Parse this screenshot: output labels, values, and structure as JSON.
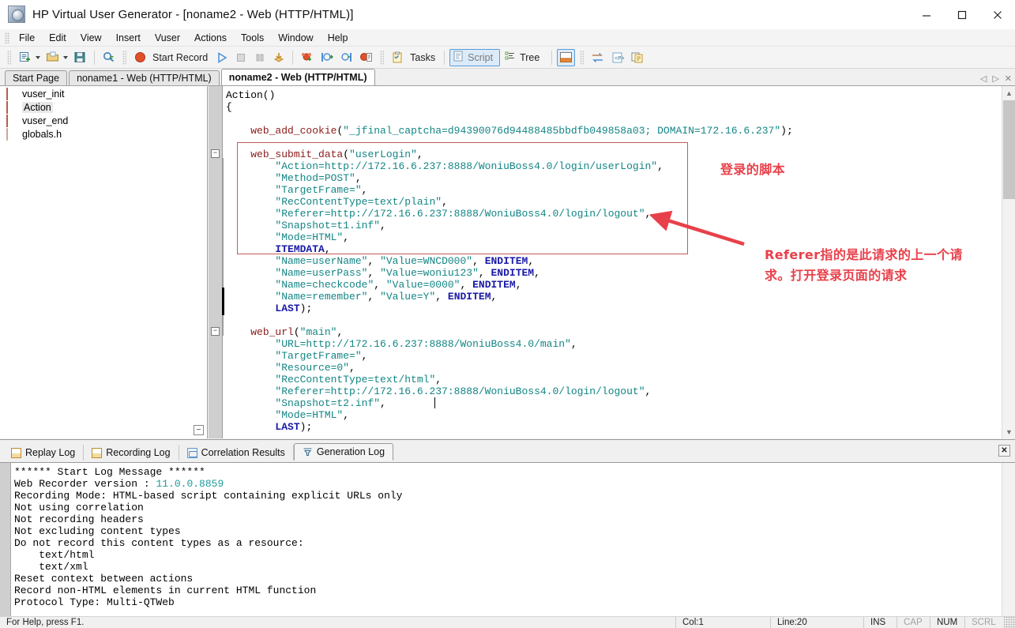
{
  "window": {
    "title": "HP Virtual User Generator - [noname2 - Web (HTTP/HTML)]",
    "app_icon": "vugen-app-icon",
    "minimize": "minimize-icon",
    "maximize": "maximize-icon",
    "close": "close-icon"
  },
  "menu": {
    "items": [
      {
        "label": "File"
      },
      {
        "label": "Edit"
      },
      {
        "label": "View"
      },
      {
        "label": "Insert"
      },
      {
        "label": "Vuser"
      },
      {
        "label": "Actions"
      },
      {
        "label": "Tools"
      },
      {
        "label": "Window"
      },
      {
        "label": "Help"
      }
    ]
  },
  "toolbar": {
    "new_script": "new-script-icon",
    "open": "open-folder-icon",
    "save": "save-disk-icon",
    "zoom": "find-icon",
    "record_dot": "record-dot-icon",
    "record_label": "Start Record",
    "run": "run-play-icon",
    "stop": "stop-icon",
    "pause": "pause-icon",
    "download": "download-icon",
    "runtime_settings": "runtime-settings-icon",
    "step_into": "step-into-icon",
    "step_out": "step-out-icon",
    "recording_options": "recording-options-icon",
    "tasks_label": "Tasks",
    "tasks_icon": "tasks-checklist-icon",
    "script_label": "Script",
    "script_icon": "script-view-icon",
    "tree_label": "Tree",
    "tree_icon": "tree-view-icon",
    "output_icon": "output-window-icon",
    "compare_icon": "compare-icon",
    "param_icon": "parameter-icon",
    "snapshot_icon": "snapshot-icon"
  },
  "document_tabs": {
    "items": [
      {
        "label": "Start Page",
        "active": false
      },
      {
        "label": "noname1 - Web (HTTP/HTML)",
        "active": false
      },
      {
        "label": "noname2 - Web (HTTP/HTML)",
        "active": true
      }
    ],
    "nav_prev": "nav-prev-icon",
    "nav_next": "nav-next-icon",
    "nav_close": "nav-close-icon"
  },
  "tree": {
    "items": [
      {
        "label": "vuser_init",
        "icon": "action-brick-icon",
        "selected": false
      },
      {
        "label": "Action",
        "icon": "action-brick-icon",
        "selected": true
      },
      {
        "label": "vuser_end",
        "icon": "action-brick-icon",
        "selected": false
      },
      {
        "label": "globals.h",
        "icon": "header-file-icon",
        "selected": false
      }
    ],
    "collapse_toggle": "collapse-minus-icon"
  },
  "code": {
    "lines": [
      [
        {
          "t": "Action()",
          "c": "plain"
        }
      ],
      [
        {
          "t": "{",
          "c": "plain"
        }
      ],
      [],
      [
        {
          "t": "    ",
          "c": "plain"
        },
        {
          "t": "web_add_cookie",
          "c": "fn"
        },
        {
          "t": "(",
          "c": "plain"
        },
        {
          "t": "\"_jfinal_captcha=d94390076d94488485bbdfb049858a03; DOMAIN=172.16.6.237\"",
          "c": "str"
        },
        {
          "t": ");",
          "c": "plain"
        }
      ],
      [],
      [
        {
          "t": "    ",
          "c": "plain"
        },
        {
          "t": "web_submit_data",
          "c": "fn"
        },
        {
          "t": "(",
          "c": "plain"
        },
        {
          "t": "\"userLogin\"",
          "c": "str"
        },
        {
          "t": ",",
          "c": "plain"
        }
      ],
      [
        {
          "t": "        ",
          "c": "plain"
        },
        {
          "t": "\"Action=http://172.16.6.237:8888/WoniuBoss4.0/login/userLogin\"",
          "c": "str"
        },
        {
          "t": ",",
          "c": "plain"
        }
      ],
      [
        {
          "t": "        ",
          "c": "plain"
        },
        {
          "t": "\"Method=POST\"",
          "c": "str"
        },
        {
          "t": ",",
          "c": "plain"
        }
      ],
      [
        {
          "t": "        ",
          "c": "plain"
        },
        {
          "t": "\"TargetFrame=\"",
          "c": "str"
        },
        {
          "t": ",",
          "c": "plain"
        }
      ],
      [
        {
          "t": "        ",
          "c": "plain"
        },
        {
          "t": "\"RecContentType=text/plain\"",
          "c": "str"
        },
        {
          "t": ",",
          "c": "plain"
        }
      ],
      [
        {
          "t": "        ",
          "c": "plain"
        },
        {
          "t": "\"Referer=http://172.16.6.237:8888/WoniuBoss4.0/login/logout\"",
          "c": "str"
        },
        {
          "t": ",",
          "c": "plain"
        }
      ],
      [
        {
          "t": "        ",
          "c": "plain"
        },
        {
          "t": "\"Snapshot=t1.inf\"",
          "c": "str"
        },
        {
          "t": ",",
          "c": "plain"
        }
      ],
      [
        {
          "t": "        ",
          "c": "plain"
        },
        {
          "t": "\"Mode=HTML\"",
          "c": "str"
        },
        {
          "t": ",",
          "c": "plain"
        }
      ],
      [
        {
          "t": "        ",
          "c": "plain"
        },
        {
          "t": "ITEMDATA",
          "c": "kw"
        },
        {
          "t": ",",
          "c": "plain"
        }
      ],
      [
        {
          "t": "        ",
          "c": "plain"
        },
        {
          "t": "\"Name=userName\"",
          "c": "str"
        },
        {
          "t": ", ",
          "c": "plain"
        },
        {
          "t": "\"Value=WNCD000\"",
          "c": "str"
        },
        {
          "t": ", ",
          "c": "plain"
        },
        {
          "t": "ENDITEM",
          "c": "kw"
        },
        {
          "t": ",",
          "c": "plain"
        }
      ],
      [
        {
          "t": "        ",
          "c": "plain"
        },
        {
          "t": "\"Name=userPass\"",
          "c": "str"
        },
        {
          "t": ", ",
          "c": "plain"
        },
        {
          "t": "\"Value=woniu123\"",
          "c": "str"
        },
        {
          "t": ", ",
          "c": "plain"
        },
        {
          "t": "ENDITEM",
          "c": "kw"
        },
        {
          "t": ",",
          "c": "plain"
        }
      ],
      [
        {
          "t": "        ",
          "c": "plain"
        },
        {
          "t": "\"Name=checkcode\"",
          "c": "str"
        },
        {
          "t": ", ",
          "c": "plain"
        },
        {
          "t": "\"Value=0000\"",
          "c": "str"
        },
        {
          "t": ", ",
          "c": "plain"
        },
        {
          "t": "ENDITEM",
          "c": "kw"
        },
        {
          "t": ",",
          "c": "plain"
        }
      ],
      [
        {
          "t": "        ",
          "c": "plain"
        },
        {
          "t": "\"Name=remember\"",
          "c": "str"
        },
        {
          "t": ", ",
          "c": "plain"
        },
        {
          "t": "\"Value=Y\"",
          "c": "str"
        },
        {
          "t": ", ",
          "c": "plain"
        },
        {
          "t": "ENDITEM",
          "c": "kw"
        },
        {
          "t": ",",
          "c": "plain"
        }
      ],
      [
        {
          "t": "        ",
          "c": "plain"
        },
        {
          "t": "LAST",
          "c": "kw"
        },
        {
          "t": ");",
          "c": "plain"
        }
      ],
      [],
      [
        {
          "t": "    ",
          "c": "plain"
        },
        {
          "t": "web_url",
          "c": "fn"
        },
        {
          "t": "(",
          "c": "plain"
        },
        {
          "t": "\"main\"",
          "c": "str"
        },
        {
          "t": ",",
          "c": "plain"
        }
      ],
      [
        {
          "t": "        ",
          "c": "plain"
        },
        {
          "t": "\"URL=http://172.16.6.237:8888/WoniuBoss4.0/main\"",
          "c": "str"
        },
        {
          "t": ",",
          "c": "plain"
        }
      ],
      [
        {
          "t": "        ",
          "c": "plain"
        },
        {
          "t": "\"TargetFrame=\"",
          "c": "str"
        },
        {
          "t": ",",
          "c": "plain"
        }
      ],
      [
        {
          "t": "        ",
          "c": "plain"
        },
        {
          "t": "\"Resource=0\"",
          "c": "str"
        },
        {
          "t": ",",
          "c": "plain"
        }
      ],
      [
        {
          "t": "        ",
          "c": "plain"
        },
        {
          "t": "\"RecContentType=text/html\"",
          "c": "str"
        },
        {
          "t": ",",
          "c": "plain"
        }
      ],
      [
        {
          "t": "        ",
          "c": "plain"
        },
        {
          "t": "\"Referer=http://172.16.6.237:8888/WoniuBoss4.0/login/logout\"",
          "c": "str"
        },
        {
          "t": ",",
          "c": "plain"
        }
      ],
      [
        {
          "t": "        ",
          "c": "plain"
        },
        {
          "t": "\"Snapshot=t2.inf\"",
          "c": "str"
        },
        {
          "t": ",",
          "c": "plain"
        }
      ],
      [
        {
          "t": "        ",
          "c": "plain"
        },
        {
          "t": "\"Mode=HTML\"",
          "c": "str"
        },
        {
          "t": ",",
          "c": "plain"
        }
      ],
      [
        {
          "t": "        ",
          "c": "plain"
        },
        {
          "t": "LAST",
          "c": "kw"
        },
        {
          "t": ");",
          "c": "plain"
        }
      ]
    ],
    "fold_markers": [
      "collapse-minus-icon",
      "collapse-minus-icon"
    ]
  },
  "annotations": {
    "login_script": "登录的脚本",
    "referer_note_line1": "Referer指的是此请求的上一个请",
    "referer_note_line2": "求。打开登录页面的请求",
    "arrow": "red-arrow-pointer",
    "color": "#e8404a"
  },
  "log_panel": {
    "tabs": [
      {
        "label": "Replay Log",
        "icon": "replay-log-icon",
        "active": false
      },
      {
        "label": "Recording Log",
        "icon": "recording-log-icon",
        "active": false
      },
      {
        "label": "Correlation Results",
        "icon": "correlation-results-icon",
        "active": false
      },
      {
        "label": "Generation Log",
        "icon": "generation-log-icon",
        "active": true
      }
    ],
    "close": "close-panel-icon",
    "lines": [
      [
        {
          "t": "****** Start Log Message ******",
          "c": "plain"
        }
      ],
      [
        {
          "t": "Web Recorder version : ",
          "c": "plain"
        },
        {
          "t": "11.0.0.8859",
          "c": "ver"
        }
      ],
      [
        {
          "t": "Recording Mode: HTML-based script containing explicit URLs only",
          "c": "plain"
        }
      ],
      [
        {
          "t": "Not using correlation",
          "c": "plain"
        }
      ],
      [
        {
          "t": "Not recording headers",
          "c": "plain"
        }
      ],
      [
        {
          "t": "Not excluding content types",
          "c": "plain"
        }
      ],
      [
        {
          "t": "Do not record this content types as a resource:",
          "c": "plain"
        }
      ],
      [
        {
          "t": "    text/html",
          "c": "plain"
        }
      ],
      [
        {
          "t": "    text/xml",
          "c": "plain"
        }
      ],
      [
        {
          "t": "Reset context between actions",
          "c": "plain"
        }
      ],
      [
        {
          "t": "Record non-HTML elements in current HTML function",
          "c": "plain"
        }
      ],
      [
        {
          "t": "Protocol Type: Multi-QTWeb",
          "c": "plain"
        }
      ]
    ]
  },
  "statusbar": {
    "help_text": "For Help, press F1.",
    "column": "Col:1",
    "line": "Line:20",
    "ins": "INS",
    "cap": "CAP",
    "num": "NUM",
    "scrl": "SCRL"
  }
}
